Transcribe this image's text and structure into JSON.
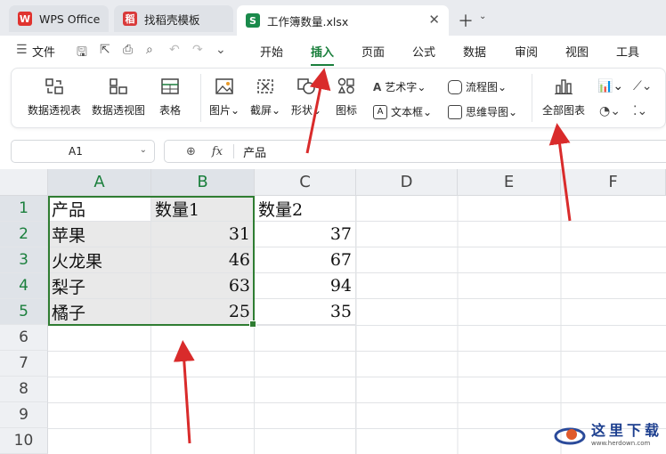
{
  "tabs": [
    {
      "label": "WPS Office",
      "icon": "wps-logo-icon",
      "color": "#e0332f"
    },
    {
      "label": "找稻壳模板",
      "icon": "docer-logo-icon",
      "color": "#d93a3a"
    },
    {
      "label": "工作簿数量.xlsx",
      "icon": "spreadsheet-icon",
      "color": "#1a8a4b"
    }
  ],
  "menu": {
    "file": "文件",
    "items": [
      "开始",
      "插入",
      "页面",
      "公式",
      "数据",
      "审阅",
      "视图",
      "工具"
    ],
    "active": "插入"
  },
  "ribbon": {
    "pivot_table": "数据透视表",
    "pivot_chart": "数据透视图",
    "table": "表格",
    "picture": "图片",
    "screenshot": "截屏",
    "shape": "形状",
    "icon": "图标",
    "wordart": "艺术字",
    "textbox": "文本框",
    "flowchart": "流程图",
    "mindmap": "思维导图",
    "all_charts": "全部图表"
  },
  "formula_bar": {
    "cell_ref": "A1",
    "fx": "fx",
    "content": "产品"
  },
  "sheet": {
    "columns": [
      "A",
      "B",
      "C",
      "D",
      "E",
      "F"
    ],
    "rows": [
      "1",
      "2",
      "3",
      "4",
      "5",
      "6",
      "7",
      "8",
      "9",
      "10"
    ],
    "header": [
      "产品",
      "数量1",
      "数量2"
    ],
    "data": [
      [
        "苹果",
        "31",
        "37"
      ],
      [
        "火龙果",
        "46",
        "67"
      ],
      [
        "梨子",
        "63",
        "94"
      ],
      [
        "橘子",
        "25",
        "35"
      ]
    ]
  },
  "watermark": {
    "text": "这里下载",
    "site": "www.herdown.com"
  },
  "colors": {
    "accent": "#1a7f3c",
    "selection_border": "#2f7d32",
    "arrow": "#d92b2b"
  }
}
